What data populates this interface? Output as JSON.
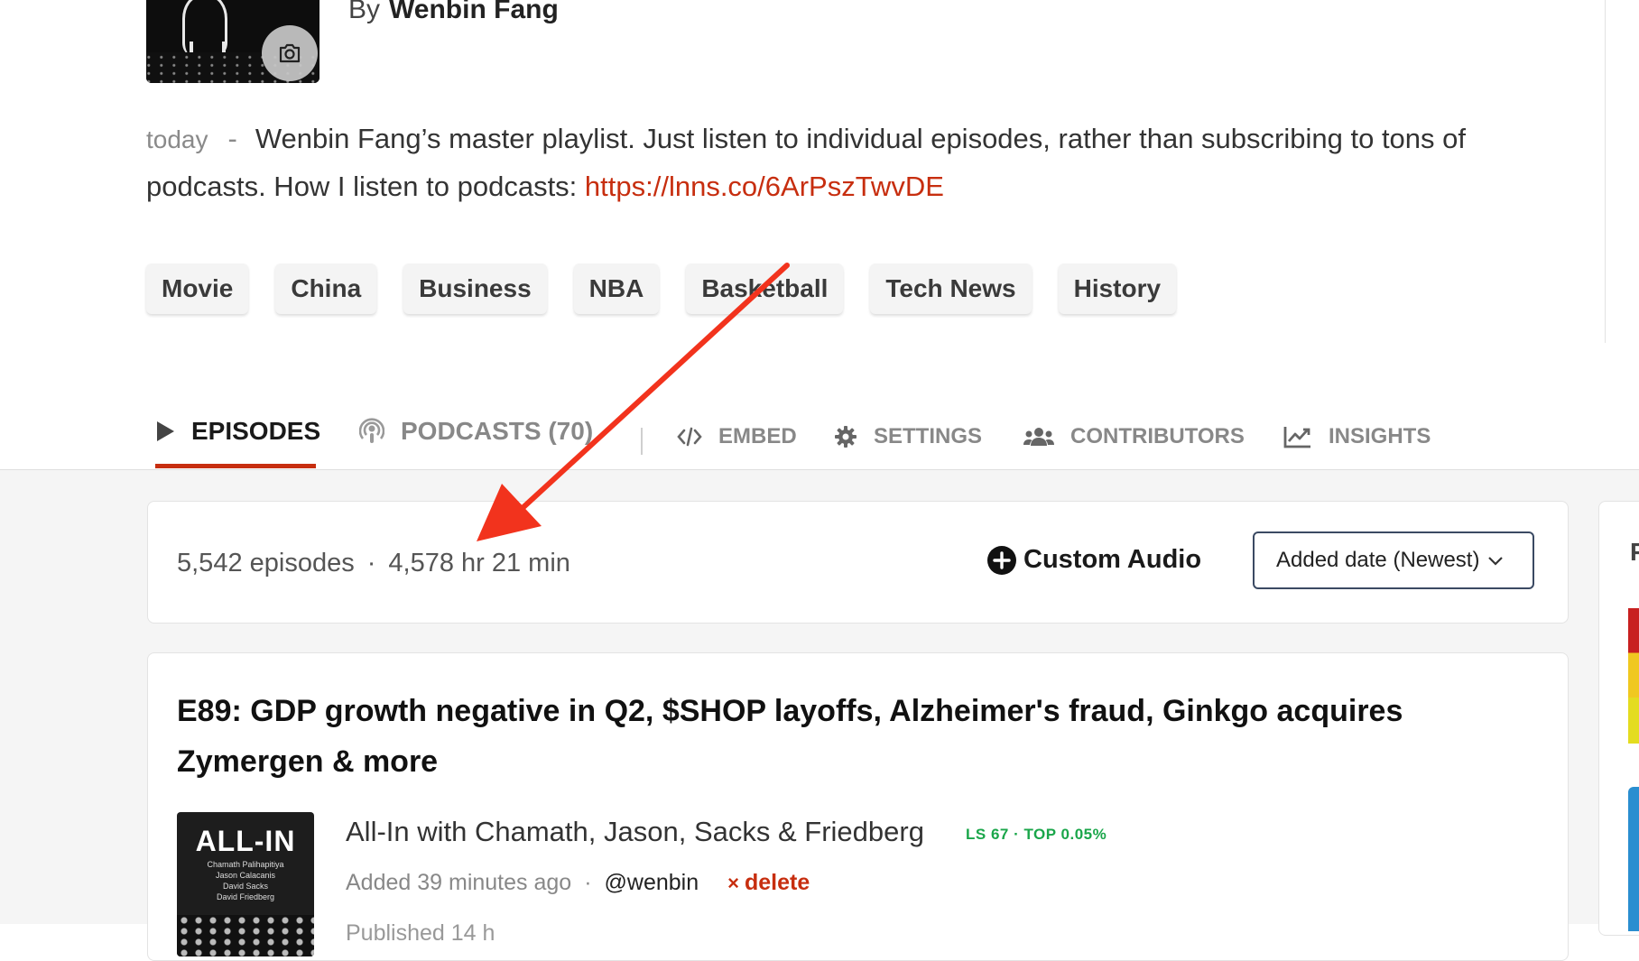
{
  "header": {
    "by_prefix": "By",
    "author": "Wenbin Fang"
  },
  "description": {
    "time": "today",
    "separator": "-",
    "text": "Wenbin Fang’s master playlist. Just listen to individual episodes, rather than subscribing to tons of podcasts. How I listen to podcasts: ",
    "link": "https://lnns.co/6ArPszTwvDE"
  },
  "tags": [
    "Movie",
    "China",
    "Business",
    "NBA",
    "Basketball",
    "Tech News",
    "History"
  ],
  "tabs": {
    "episodes": "EPISODES",
    "podcasts": "PODCASTS (70)",
    "embed": "EMBED",
    "settings": "SETTINGS",
    "contributors": "CONTRIBUTORS",
    "insights": "INSIGHTS"
  },
  "stats": {
    "episodes": "5,542 episodes",
    "dot": "·",
    "duration": "4,578 hr 21 min",
    "custom_audio_label": "Custom Audio",
    "sort_selected": "Added date (Newest)"
  },
  "episode": {
    "title": "E89: GDP growth negative in Q2, $SHOP layoffs, Alzheimer's fraud, Ginkgo acquires Zymergen & more",
    "art_logo": "ALL-IN",
    "art_hosts": [
      "Chamath Palihapitiya",
      "Jason Calacanis",
      "David Sacks",
      "David Friedberg"
    ],
    "podcast_name": "All-In with Chamath, Jason, Sacks & Friedberg",
    "listen_score": "LS 67 · TOP 0.05%",
    "added": "Added 39 minutes ago",
    "dot": "·",
    "user": "@wenbin",
    "delete_mark": "×",
    "delete_label": "delete",
    "published_partial": "Published 14 h"
  },
  "side_panel": {
    "initial": "P"
  },
  "colors": {
    "accent": "#c72e0f",
    "listen_score": "#1aa64a",
    "annotation_arrow": "#f2331d"
  },
  "icons": [
    "camera-icon",
    "play-icon",
    "podcast-icon",
    "code-icon",
    "gear-icon",
    "users-icon",
    "chart-line-icon",
    "plus-circle-icon",
    "chevron-down-icon"
  ]
}
